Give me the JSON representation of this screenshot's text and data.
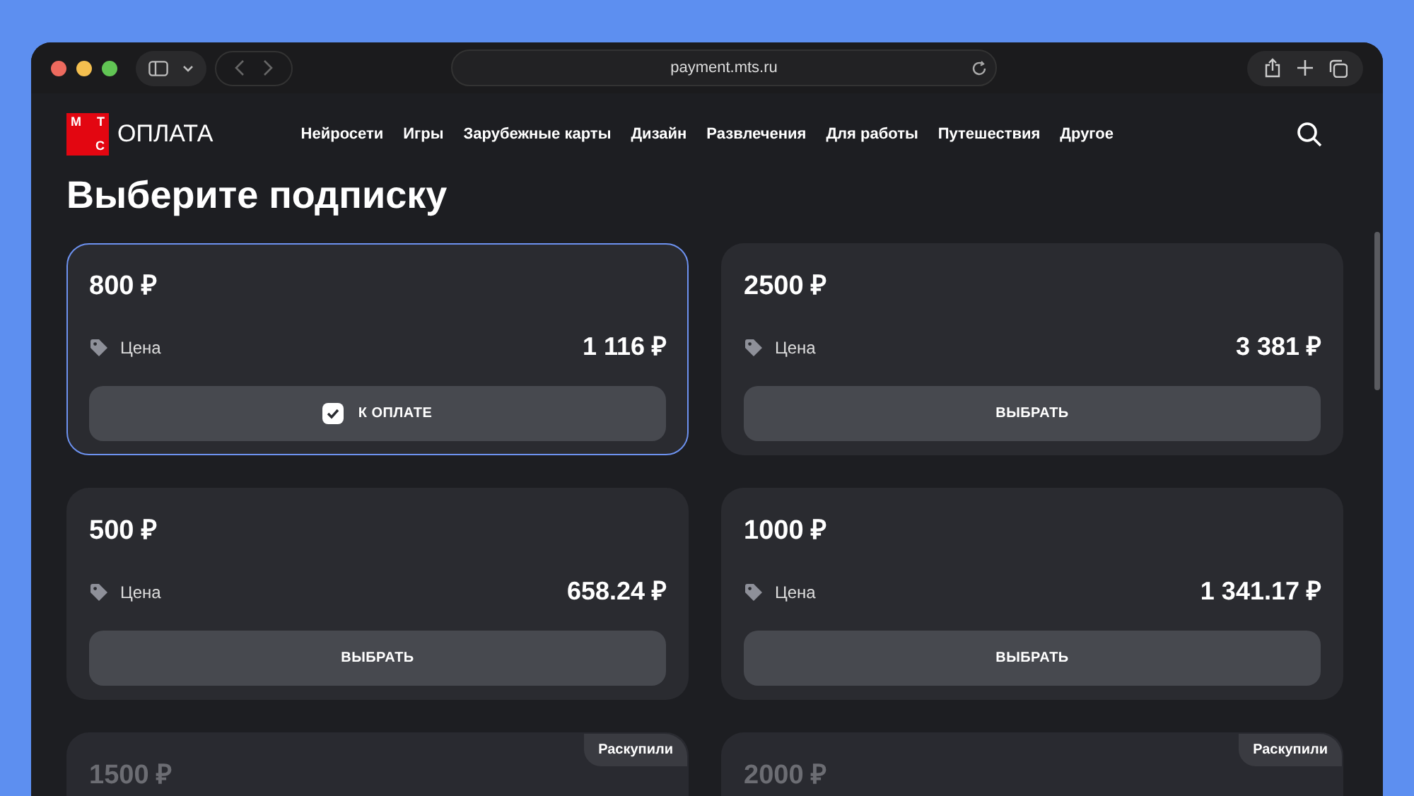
{
  "browser": {
    "url": "payment.mts.ru"
  },
  "header": {
    "logo_letters": [
      "М",
      "Т",
      "С"
    ],
    "logo_text": "ОПЛАТА",
    "nav": [
      {
        "label": "Нейросети"
      },
      {
        "label": "Игры"
      },
      {
        "label": "Зарубежные карты"
      },
      {
        "label": "Дизайн"
      },
      {
        "label": "Развлечения"
      },
      {
        "label": "Для работы"
      },
      {
        "label": "Путешествия"
      },
      {
        "label": "Другое"
      }
    ]
  },
  "title": "Выберите подписку",
  "plans": [
    {
      "amount": "800 ₽",
      "price_label": "Цена",
      "price": "1 116 ₽",
      "button": "К ОПЛАТЕ",
      "selected": true,
      "sold_out": false
    },
    {
      "amount": "2500 ₽",
      "price_label": "Цена",
      "price": "3 381 ₽",
      "button": "ВЫБРАТЬ",
      "selected": false,
      "sold_out": false
    },
    {
      "amount": "500 ₽",
      "price_label": "Цена",
      "price": "658.24 ₽",
      "button": "ВЫБРАТЬ",
      "selected": false,
      "sold_out": false
    },
    {
      "amount": "1000 ₽",
      "price_label": "Цена",
      "price": "1 341.17 ₽",
      "button": "ВЫБРАТЬ",
      "selected": false,
      "sold_out": false
    },
    {
      "amount": "1500 ₽",
      "badge": "Раскупили",
      "selected": false,
      "sold_out": true
    },
    {
      "amount": "2000 ₽",
      "badge": "Раскупили",
      "selected": false,
      "sold_out": true
    }
  ]
}
